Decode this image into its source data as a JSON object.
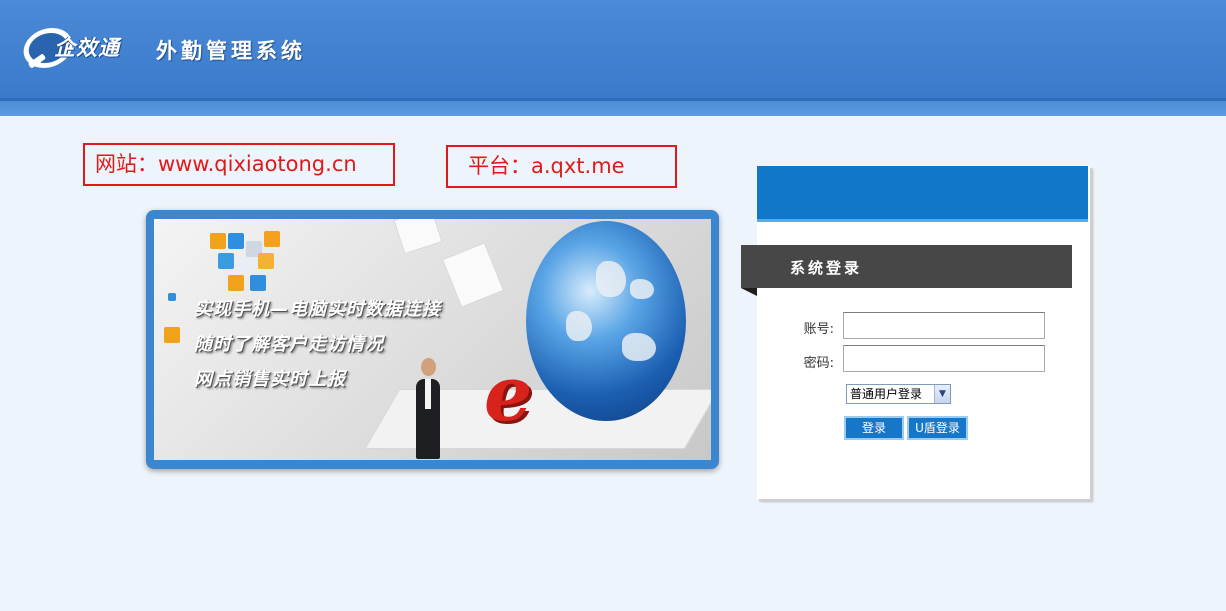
{
  "header": {
    "logo_text": "企效通",
    "system_title": "外勤管理系统"
  },
  "notices": {
    "website": "网站：www.qixiaotong.cn",
    "platform": "平台：a.qxt.me"
  },
  "banner": {
    "lines": [
      "实现手机—电脑实时数据连接",
      "随时了解客户走访情况",
      "网点销售实时上报"
    ]
  },
  "login": {
    "title": "系统登录",
    "account_label": "账号:",
    "account_value": "",
    "password_label": "密码:",
    "password_value": "",
    "login_type_selected": "普通用户登录",
    "login_button": "登录",
    "ukey_button": "U盾登录"
  },
  "colors": {
    "header_blue": "#3d7ece",
    "notice_red": "#e01a1a",
    "panel_blue": "#1177c8",
    "ribbon_gray": "#474747"
  }
}
